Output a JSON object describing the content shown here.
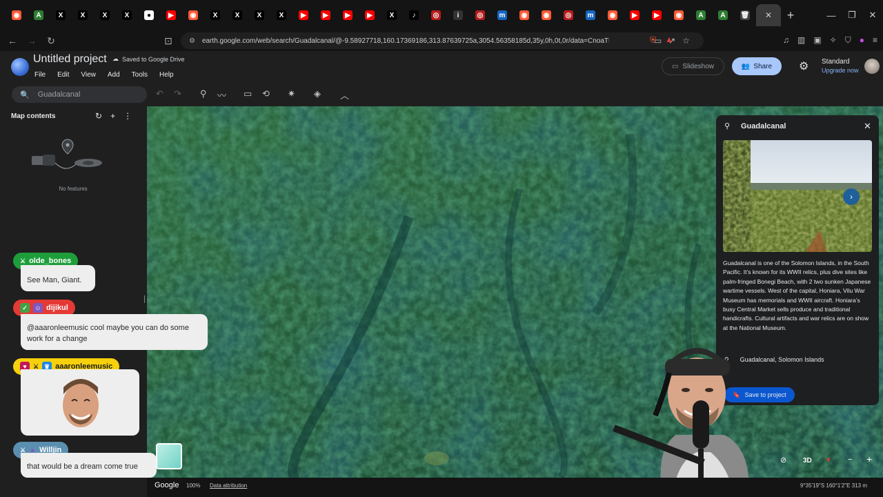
{
  "browser": {
    "tabs": [
      {
        "icon": "brave-icon",
        "glyph": "◉",
        "color": "#ff5a36"
      },
      {
        "icon": "app-icon",
        "glyph": "A",
        "color": "#2e7d32"
      },
      {
        "icon": "x-icon",
        "glyph": "X",
        "color": "#000000"
      },
      {
        "icon": "x-icon",
        "glyph": "X",
        "color": "#000000"
      },
      {
        "icon": "x-icon",
        "glyph": "X",
        "color": "#000000"
      },
      {
        "icon": "x-icon",
        "glyph": "X",
        "color": "#000000"
      },
      {
        "icon": "circle-icon",
        "glyph": "●",
        "color": "#ffffff"
      },
      {
        "icon": "youtube-icon",
        "glyph": "▶",
        "color": "#ff0000"
      },
      {
        "icon": "brave-icon",
        "glyph": "◉",
        "color": "#ff5a36"
      },
      {
        "icon": "x-icon",
        "glyph": "X",
        "color": "#000000"
      },
      {
        "icon": "x-icon",
        "glyph": "X",
        "color": "#000000"
      },
      {
        "icon": "x-icon",
        "glyph": "X",
        "color": "#000000"
      },
      {
        "icon": "x-icon",
        "glyph": "X",
        "color": "#000000"
      },
      {
        "icon": "youtube-icon",
        "glyph": "▶",
        "color": "#ff0000"
      },
      {
        "icon": "youtube-icon",
        "glyph": "▶",
        "color": "#ff0000"
      },
      {
        "icon": "youtube-icon",
        "glyph": "▶",
        "color": "#ff0000"
      },
      {
        "icon": "youtube-icon",
        "glyph": "▶",
        "color": "#ff0000"
      },
      {
        "icon": "x-icon",
        "glyph": "X",
        "color": "#000000"
      },
      {
        "icon": "tiktok-icon",
        "glyph": "♪",
        "color": "#000000"
      },
      {
        "icon": "record-icon",
        "glyph": "◎",
        "color": "#b71c1c"
      },
      {
        "icon": "app-icon",
        "glyph": "i",
        "color": "#333333"
      },
      {
        "icon": "record-icon",
        "glyph": "◎",
        "color": "#b71c1c"
      },
      {
        "icon": "m-icon",
        "glyph": "m",
        "color": "#1565c0"
      },
      {
        "icon": "brave-icon",
        "glyph": "◉",
        "color": "#ff5a36"
      },
      {
        "icon": "brave-icon",
        "glyph": "◉",
        "color": "#ff5a36"
      },
      {
        "icon": "record-icon",
        "glyph": "◎",
        "color": "#b71c1c"
      },
      {
        "icon": "m-icon",
        "glyph": "m",
        "color": "#1565c0"
      },
      {
        "icon": "brave-icon",
        "glyph": "◉",
        "color": "#ff5a36"
      },
      {
        "icon": "youtube-icon",
        "glyph": "▶",
        "color": "#ff0000"
      },
      {
        "icon": "youtube-icon",
        "glyph": "▶",
        "color": "#ff0000"
      },
      {
        "icon": "brave-icon",
        "glyph": "◉",
        "color": "#ff5a36"
      },
      {
        "icon": "app-icon",
        "glyph": "A",
        "color": "#2e7d32"
      },
      {
        "icon": "app-icon",
        "glyph": "A",
        "color": "#2e7d32"
      },
      {
        "icon": "trash-icon",
        "glyph": "🗑",
        "color": "#444444"
      }
    ],
    "active_tab_close": "✕",
    "new_tab": "+",
    "url": "earth.google.com/web/search/Guadalcanal/@-9.58927718,160.17369186,313.87639725a,3054.56358185d,35y,0h,0t,0r/data=CnoaTBJGCiUweD..."
  },
  "app": {
    "title": "Untitled project",
    "saved_status": "Saved to Google Drive",
    "menu": [
      "File",
      "Edit",
      "View",
      "Add",
      "Tools",
      "Help"
    ],
    "slideshow_label": "Slideshow",
    "share_label": "Share",
    "plan_name": "Standard",
    "upgrade_label": "Upgrade now",
    "accent": "#a8c7fa"
  },
  "search": {
    "value": "Guadalcanal"
  },
  "map_contents": {
    "title": "Map contents",
    "empty_text": "No features"
  },
  "info_panel": {
    "title": "Guadalcanal",
    "description": "Guadalcanal is one of the Solomon Islands, in the South Pacific. It’s known for its WWII relics, plus dive sites like palm-fringed Bonegi Beach, with 2 two sunken Japanese wartime vessels. West of the capital, Honiara, Vilu War Museum has memorials and WWII aircraft. Honiara’s busy Central Market sells produce and traditional handicrafts. Cultural artifacts and war relics are on show at the National Museum.",
    "location": "Guadalcanal, Solomon Islands",
    "save_label": "Save to project"
  },
  "map_controls": {
    "view_3d": "3D"
  },
  "bottom_bar": {
    "brand": "Google",
    "zoom": "100%",
    "attribution": "Data attribution",
    "coords": "9°35'19\"S 160°1'2\"E  313 m"
  },
  "chat": [
    {
      "user": "olde_bones",
      "user_color": "#1e9e3a",
      "message": "See Man, Giant."
    },
    {
      "user": "dijikul",
      "user_color": "#e53935",
      "message": "@aaaronleemusic cool maybe you can do some work for a change"
    },
    {
      "user": "aaaronleemusic",
      "user_color": "#f6d10c",
      "message": ""
    },
    {
      "user": "Willjin",
      "user_color": "#5b8fb0",
      "message": "that would be a dream come true"
    }
  ]
}
